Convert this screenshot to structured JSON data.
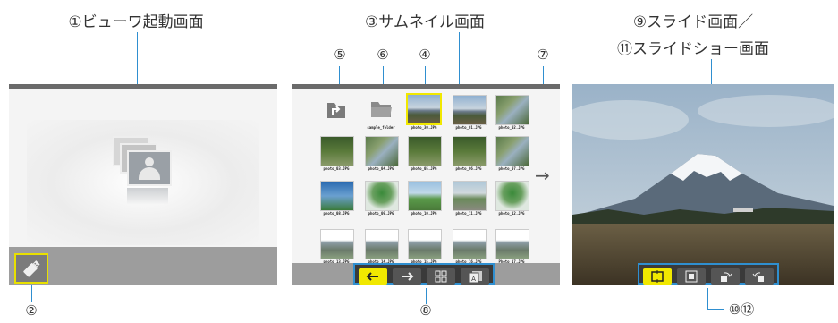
{
  "captions": {
    "viewer_start": "①ビューワ起動画面",
    "thumbnail": "③サムネイル画面",
    "slide_line1": "⑨スライド画面／",
    "slide_line2": "⑪スライドショー画面"
  },
  "numbers": {
    "n2": "②",
    "n4": "④",
    "n5": "⑤",
    "n6": "⑥",
    "n7": "⑦",
    "n8": "⑧",
    "n10_12": "⑩⑫"
  },
  "thumbnail_screen": {
    "items": [
      {
        "name": "",
        "type": "up-folder"
      },
      {
        "name": "sample_folder",
        "type": "folder"
      },
      {
        "name": "photo_30.JPG",
        "type": "photo-mountain",
        "selected": true
      },
      {
        "name": "photo_01.JPG",
        "type": "photo-mountain"
      },
      {
        "name": "photo_02.JPG",
        "type": "photo-river"
      },
      {
        "name": "photo_03.JPG",
        "type": "photo-forest"
      },
      {
        "name": "photo_04.JPG",
        "type": "photo-river"
      },
      {
        "name": "photo_05.JPG",
        "type": "photo-forest"
      },
      {
        "name": "photo_06.JPG",
        "type": "photo-forest"
      },
      {
        "name": "photo_07.JPG",
        "type": "photo-river"
      },
      {
        "name": "photo_08.JPG",
        "type": "photo-sky"
      },
      {
        "name": "photo_09.JPG",
        "type": "photo-tree"
      },
      {
        "name": "photo_10.JPG",
        "type": "photo-field"
      },
      {
        "name": "photo_11.JPG",
        "type": "photo-city"
      },
      {
        "name": "photo_12.JPG",
        "type": "photo-tree"
      },
      {
        "name": "photo_13.JPG",
        "type": "placeholder"
      },
      {
        "name": "photo_14.JPG",
        "type": "placeholder"
      },
      {
        "name": "photo_15.JPG",
        "type": "placeholder"
      },
      {
        "name": "photo_16.JPG",
        "type": "placeholder"
      },
      {
        "name": "Photo_17.JPG",
        "type": "placeholder"
      }
    ],
    "next_arrow": "→",
    "toolbar_icons": [
      "arrow-left-icon",
      "arrow-right-icon",
      "grid-icon",
      "slideshow-icon"
    ]
  },
  "slide_screen": {
    "toolbar_icons": [
      "fit-screen-icon",
      "actual-size-icon",
      "rotate-right-icon",
      "rotate-left-icon"
    ]
  },
  "colors": {
    "callout_line": "#2f8fd0",
    "selection": "#f1e800",
    "toolbar_bg": "#3a3a3a"
  }
}
